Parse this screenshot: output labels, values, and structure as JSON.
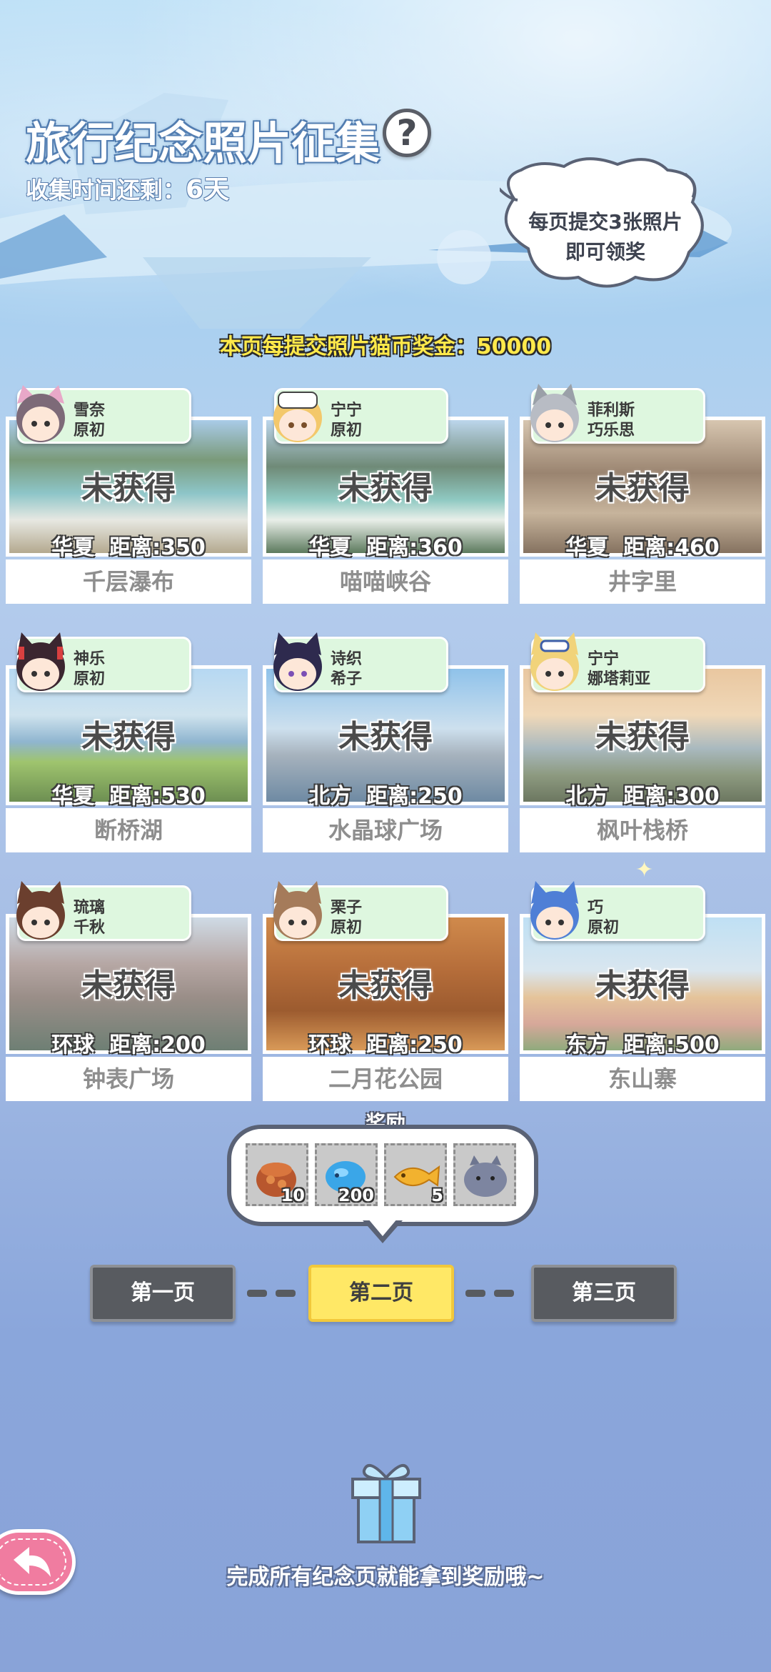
{
  "header": {
    "title": "旅行纪念照片征集",
    "help_symbol": "?",
    "remaining_label": "收集时间还剩：",
    "remaining_value": "6天",
    "bubble_line1": "每页提交3张照片",
    "bubble_line2": "即可领奖",
    "bonus_text": "本页每提交照片猫币奖金：50000"
  },
  "cards": [
    {
      "char1": "雪奈",
      "char2": "原初",
      "status": "未获得",
      "dist": "华夏  距离:350",
      "name": "千层瀑布"
    },
    {
      "char1": "宁宁",
      "char2": "原初",
      "status": "未获得",
      "dist": "华夏  距离:360",
      "name": "喵喵峡谷"
    },
    {
      "char1": "菲利斯",
      "char2": "巧乐思",
      "status": "未获得",
      "dist": "华夏  距离:460",
      "name": "井字里"
    },
    {
      "char1": "神乐",
      "char2": "原初",
      "status": "未获得",
      "dist": "华夏  距离:530",
      "name": "断桥湖"
    },
    {
      "char1": "诗织",
      "char2": "希子",
      "status": "未获得",
      "dist": "北方  距离:250",
      "name": "水晶球广场"
    },
    {
      "char1": "宁宁",
      "char2": "娜塔莉亚",
      "status": "未获得",
      "dist": "北方  距离:300",
      "name": "枫叶栈桥"
    },
    {
      "char1": "琉璃",
      "char2": "千秋",
      "status": "未获得",
      "dist": "环球  距离:200",
      "name": "钟表广场"
    },
    {
      "char1": "栗子",
      "char2": "原初",
      "status": "未获得",
      "dist": "环球  距离:250",
      "name": "二月花公园"
    },
    {
      "char1": "巧",
      "char2": "原初",
      "status": "未获得",
      "dist": "东方  距离:500",
      "name": "东山寨"
    }
  ],
  "reward": {
    "title": "奖励",
    "items": [
      {
        "icon": "food-bag-icon",
        "count": "10"
      },
      {
        "icon": "blue-fish-icon",
        "count": "200"
      },
      {
        "icon": "golden-fish-icon",
        "count": "5"
      },
      {
        "icon": "gray-cat-plush-icon",
        "count": ""
      }
    ]
  },
  "pages": {
    "page1": "第一页",
    "page2": "第二页",
    "page3": "第三页",
    "active": "page2"
  },
  "footer": {
    "text": "完成所有纪念页就能拿到奖励哦~"
  },
  "colors": {
    "tag_bg": "#def7df",
    "active_page": "#ffe866",
    "dark_page": "#585b60",
    "back_button": "#f07ca0",
    "bonus_text": "#ffe94a"
  }
}
